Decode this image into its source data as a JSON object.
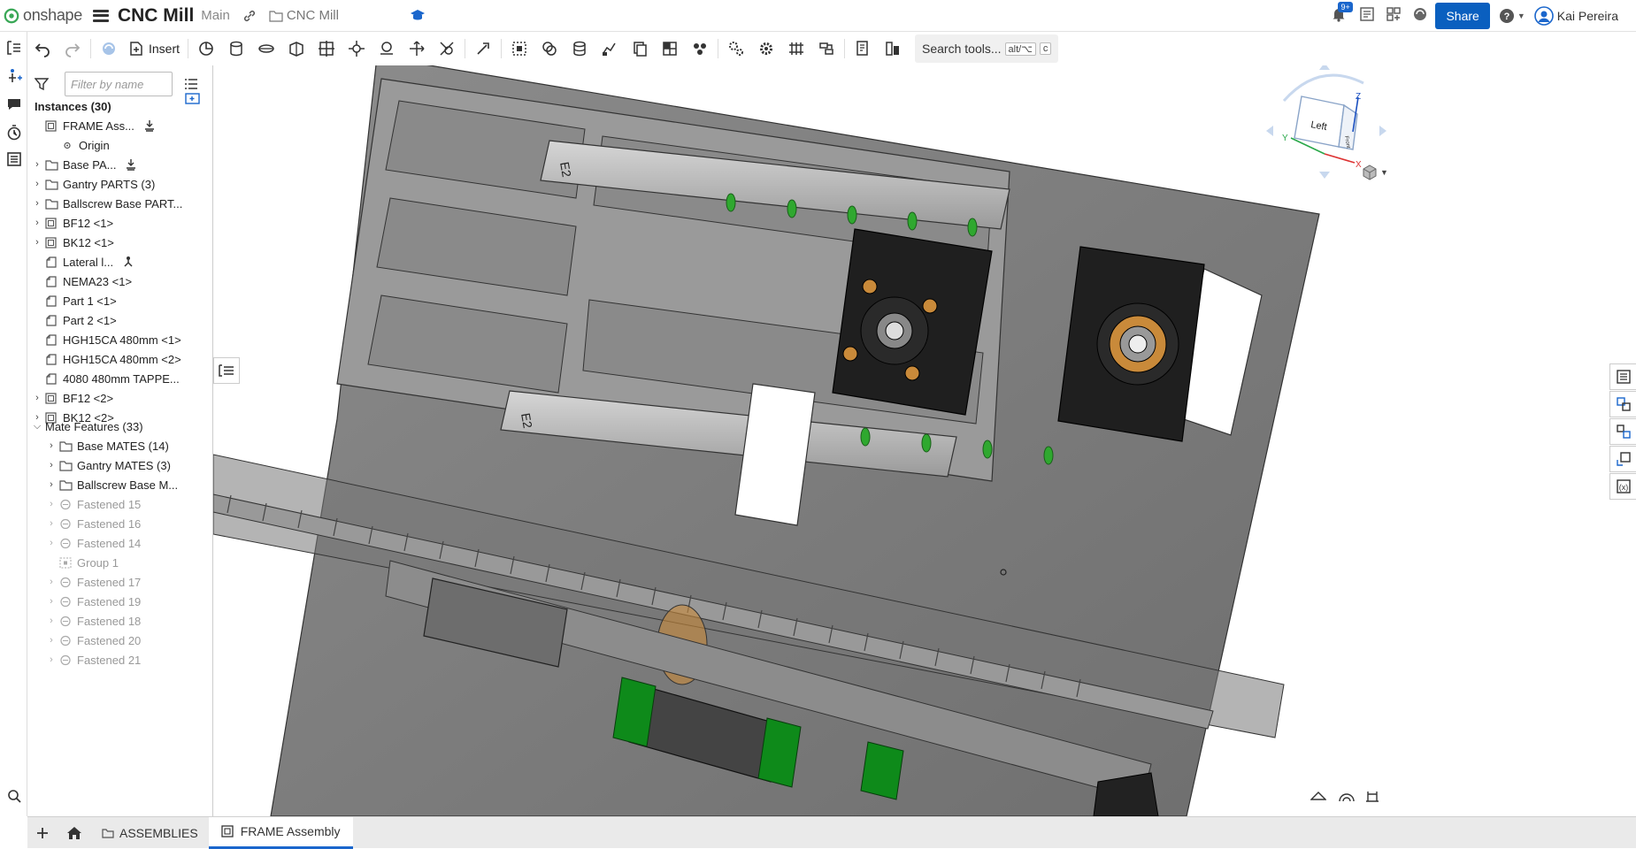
{
  "app": {
    "logo_text": "onshape",
    "doc_title": "CNC Mill",
    "branch": "Main",
    "folder": "CNC Mill",
    "notification_count": "9+",
    "share_label": "Share",
    "user_name": "Kai Pereira"
  },
  "toolbar": {
    "insert_label": "Insert",
    "search_label": "Search tools...",
    "search_kbd1": "alt/⌥",
    "search_kbd2": "c"
  },
  "panel": {
    "filter_placeholder": "Filter by name",
    "instances_header": "Instances (30)",
    "items": [
      {
        "label": "FRAME Ass...",
        "kind": "assembly",
        "caret": ""
      },
      {
        "label": "Origin",
        "kind": "origin",
        "caret": ""
      },
      {
        "label": "Base PA...",
        "kind": "folder",
        "caret": "›"
      },
      {
        "label": "Gantry PARTS (3)",
        "kind": "folder",
        "caret": "›"
      },
      {
        "label": "Ballscrew Base PART...",
        "kind": "folder",
        "caret": "›"
      },
      {
        "label": "BF12 <1>",
        "kind": "assembly",
        "caret": "›"
      },
      {
        "label": "BK12 <1>",
        "kind": "assembly",
        "caret": "›"
      },
      {
        "label": "Lateral l...",
        "kind": "part",
        "caret": ""
      },
      {
        "label": "NEMA23 <1>",
        "kind": "part",
        "caret": ""
      },
      {
        "label": "Part 1 <1>",
        "kind": "part",
        "caret": ""
      },
      {
        "label": "Part 2 <1>",
        "kind": "part",
        "caret": ""
      },
      {
        "label": "HGH15CA 480mm <1>",
        "kind": "part",
        "caret": ""
      },
      {
        "label": "HGH15CA 480mm <2>",
        "kind": "part",
        "caret": ""
      },
      {
        "label": "4080 480mm TAPPE...",
        "kind": "part",
        "caret": ""
      },
      {
        "label": "BF12 <2>",
        "kind": "assembly",
        "caret": "›"
      },
      {
        "label": "BK12 <2>",
        "kind": "assembly",
        "caret": "›"
      }
    ],
    "mates_header": "Mate Features (33)",
    "mates": [
      {
        "label": "Base MATES (14)",
        "kind": "folder",
        "dim": false
      },
      {
        "label": "Gantry MATES (3)",
        "kind": "folder",
        "dim": false
      },
      {
        "label": "Ballscrew Base M...",
        "kind": "folder",
        "dim": false
      },
      {
        "label": "Fastened 15",
        "kind": "mate",
        "dim": true
      },
      {
        "label": "Fastened 16",
        "kind": "mate",
        "dim": true
      },
      {
        "label": "Fastened 14",
        "kind": "mate",
        "dim": true
      },
      {
        "label": "Group 1",
        "kind": "group",
        "dim": true
      },
      {
        "label": "Fastened 17",
        "kind": "mate",
        "dim": true
      },
      {
        "label": "Fastened 19",
        "kind": "mate",
        "dim": true
      },
      {
        "label": "Fastened 18",
        "kind": "mate",
        "dim": true
      },
      {
        "label": "Fastened 20",
        "kind": "mate",
        "dim": true
      },
      {
        "label": "Fastened 21",
        "kind": "mate",
        "dim": true
      }
    ]
  },
  "viewcube": {
    "face_left": "Left",
    "face_front": "Front",
    "axis_x": "X",
    "axis_y": "Y",
    "axis_z": "Z"
  },
  "rail_labels": {
    "e2_top": "E2",
    "e2_bottom": "E2"
  },
  "tabs": {
    "assemblies": "ASSEMBLIES",
    "frame": "FRAME Assembly"
  },
  "colors": {
    "accent": "#0a5fbf",
    "rail_green": "#2fa82f",
    "block_green": "#0e8a1a",
    "bearing_orange": "#c98a3a"
  }
}
